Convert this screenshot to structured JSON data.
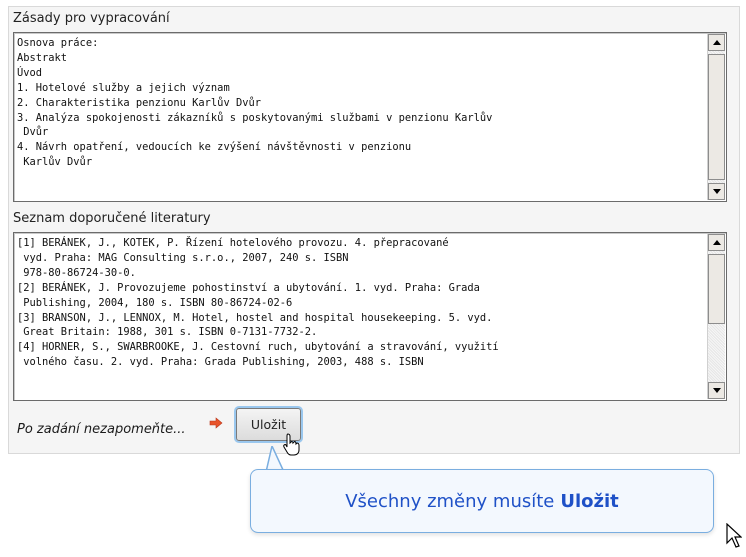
{
  "section1": {
    "heading": "Zásady pro vypracování",
    "lines": [
      "Osnova práce:",
      "Abstrakt",
      "Úvod",
      "1. Hotelové služby a jejich význam",
      "2. Charakteristika penzionu Karlův Dvůr",
      "3. Analýza spokojenosti zákazníků s poskytovanými službami v penzionu Karlův",
      " Dvůr",
      "4. Návrh opatření, vedoucích ke zvýšení návštěvnosti v penzionu",
      " Karlův Dvůr"
    ]
  },
  "section2": {
    "heading": "Seznam doporučené literatury",
    "lines": [
      "[1] BERÁNEK, J., KOTEK, P. Řízení hotelového provozu. 4. přepracované",
      " vyd. Praha: MAG Consulting s.r.o., 2007, 240 s. ISBN",
      " 978-80-86724-30-0.",
      "[2] BERÁNEK, J. Provozujeme pohostinství a ubytování. 1. vyd. Praha: Grada",
      " Publishing, 2004, 180 s. ISBN 80-86724-02-6",
      "[3] BRANSON, J., LENNOX, M. Hotel, hostel and hospital housekeeping. 5. vyd.",
      " Great Britain: 1988, 301 s. ISBN 0-7131-7732-2.",
      "[4] HORNER, S., SWARBROOKE, J. Cestovní ruch, ubytování a stravování, využití",
      " volného času. 2. vyd. Praha: Grada Publishing, 2003, 488 s. ISBN"
    ]
  },
  "footer": {
    "hint": "Po zadání nezapomeňte...",
    "save_label": "Uložit"
  },
  "tooltip": {
    "text": "Všechny změny musíte",
    "bold": "Uložit"
  },
  "colors": {
    "tooltip_text": "#1f51c7",
    "tooltip_border": "#7aaee0",
    "arrow": "#e8532a"
  },
  "icons": [
    "scroll-up-icon",
    "scroll-down-icon",
    "red-arrow-icon",
    "hand-cursor-icon",
    "pointer-cursor-icon"
  ]
}
